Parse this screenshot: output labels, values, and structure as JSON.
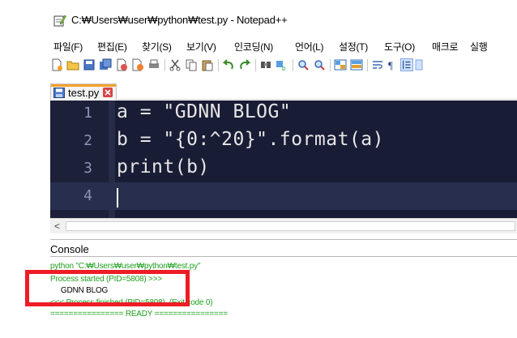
{
  "window": {
    "title": "C:₩Users₩user₩python₩test.py - Notepad++"
  },
  "menu": {
    "items": [
      "파일(F)",
      "편집(E)",
      "찾기(S)",
      "보기(V)",
      "인코딩(N)",
      "언어(L)",
      "설정(T)",
      "도구(O)",
      "매크로",
      "실행"
    ]
  },
  "toolbar": {
    "icons": [
      "new-file-icon",
      "open-file-icon",
      "save-icon",
      "save-all-icon",
      "close-icon",
      "close-all-icon",
      "print-icon",
      "cut-icon",
      "copy-icon",
      "paste-icon",
      "undo-icon",
      "redo-icon",
      "find-icon",
      "replace-icon",
      "zoom-in-icon",
      "zoom-out-icon",
      "sync-vertical-icon",
      "sync-horizontal-icon",
      "word-wrap-icon",
      "show-all-chars-icon",
      "indent-guide-icon"
    ]
  },
  "tab": {
    "label": "test.py",
    "accent_color": "#f6a02b"
  },
  "editor": {
    "lines": [
      {
        "num": "1",
        "code": "a = \"GDNN BLOG\""
      },
      {
        "num": "2",
        "code": "b = \"{0:^20}\".format(a)"
      },
      {
        "num": "3",
        "code": "print(b)"
      },
      {
        "num": "4",
        "code": ""
      }
    ],
    "background": "#191c35"
  },
  "scrollbar": {
    "left_arrow": "<"
  },
  "console": {
    "title": "Console",
    "lines": [
      {
        "text": "python \"C:₩Users₩user₩python₩test.py\"",
        "color": "green"
      },
      {
        "text": "Process started (PID=5808) >>>",
        "color": "green"
      },
      {
        "text": "     GDNN BLOG",
        "color": "black"
      },
      {
        "text": "<<< Process finished (PID=5808). (Exit code 0)",
        "color": "green"
      },
      {
        "text": "================ READY ================",
        "color": "green"
      }
    ]
  },
  "annotation": {
    "highlight_color": "#ee1c25"
  }
}
